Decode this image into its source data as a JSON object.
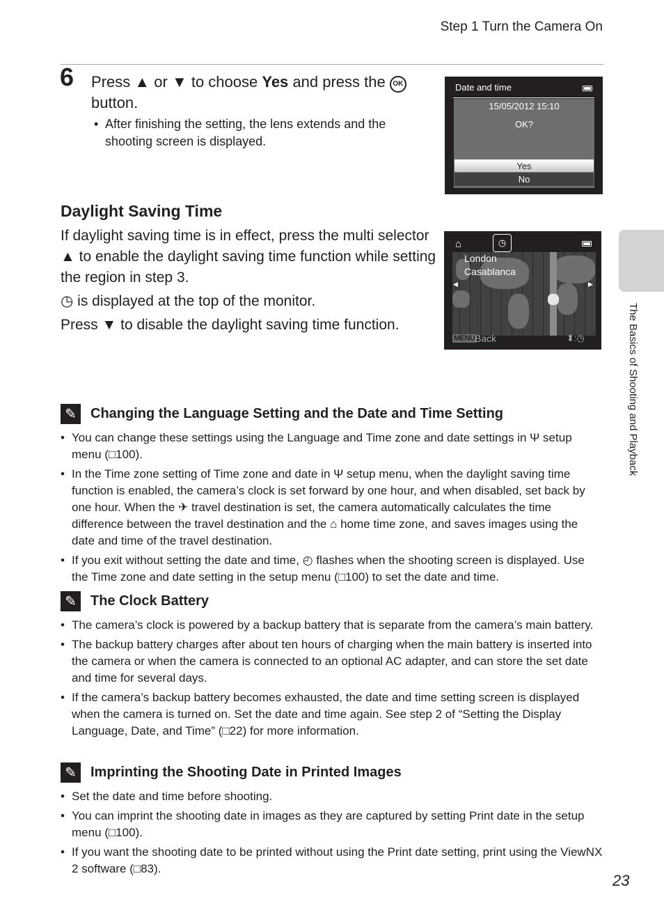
{
  "running_head": "Step 1 Turn the Camera On",
  "step": {
    "number": "6",
    "title_parts": [
      "Press ",
      "▲",
      " or ",
      "▼",
      " to choose ",
      "Yes",
      " and press the ",
      "®",
      " button."
    ],
    "bullets": [
      "After finishing the setting, the lens extends and the shooting screen is displayed."
    ]
  },
  "screen_date_time": {
    "title": "Date and time",
    "datetime": "15/05/2012  15:10",
    "prompt": "OK?",
    "options": [
      "Yes",
      "No"
    ],
    "selected": "Yes"
  },
  "screen_time_zone": {
    "home_icon": "⌂",
    "dst_icon": "◷",
    "cities": [
      "London",
      "Casablanca"
    ],
    "menu_label": "MENU",
    "back_label": "Back",
    "legend": "⬍:◷"
  },
  "daylight_saving": {
    "title": "Daylight Saving Time",
    "paragraphs": [
      "If daylight saving time is in effect, press the multi selector ▲ to enable the daylight saving time function while setting the region in step 3.",
      "◷ is displayed at the top of the monitor.",
      "Press ▼ to disable the daylight saving time function."
    ]
  },
  "notes": [
    {
      "title": "Changing the Language Setting and the Date and Time Setting",
      "items": [
        "You can change these settings using the Language and Time zone and date settings in Ψ setup menu (□100).",
        "In the Time zone setting of Time zone and date in Ψ setup menu, when the daylight saving time function is enabled, the camera’s clock is set forward by one hour, and when disabled, set back by one hour. When the ✈ travel destination is set, the camera automatically calculates the time difference between the travel destination and the ⌂ home time zone, and saves images using the date and time of the travel destination.",
        "If you exit without setting the date and time, ◴ flashes when the shooting screen is displayed. Use the Time zone and date setting in the setup menu (□100) to set the date and time."
      ]
    },
    {
      "title": "The Clock Battery",
      "items": [
        "The camera’s clock is powered by a backup battery that is separate from the camera’s main battery.",
        "The backup battery charges after about ten hours of charging when the main battery is inserted into the camera or when the camera is connected to an optional AC adapter, and can store the set date and time for several days.",
        "If the camera’s backup battery becomes exhausted, the date and time setting screen is displayed when the camera is turned on. Set the date and time again. See step 2 of “Setting the Display Language, Date, and Time” (□22) for more information."
      ]
    },
    {
      "title": "Imprinting the Shooting Date in Printed Images",
      "items": [
        "Set the date and time before shooting.",
        "You can imprint the shooting date in images as they are captured by setting Print date in the setup menu (□100).",
        "If you want the shooting date to be printed without using the Print date setting, print using the ViewNX 2 software (□83)."
      ]
    }
  ],
  "side_tab_label": "The Basics of Shooting and Playback",
  "page_number": "23"
}
